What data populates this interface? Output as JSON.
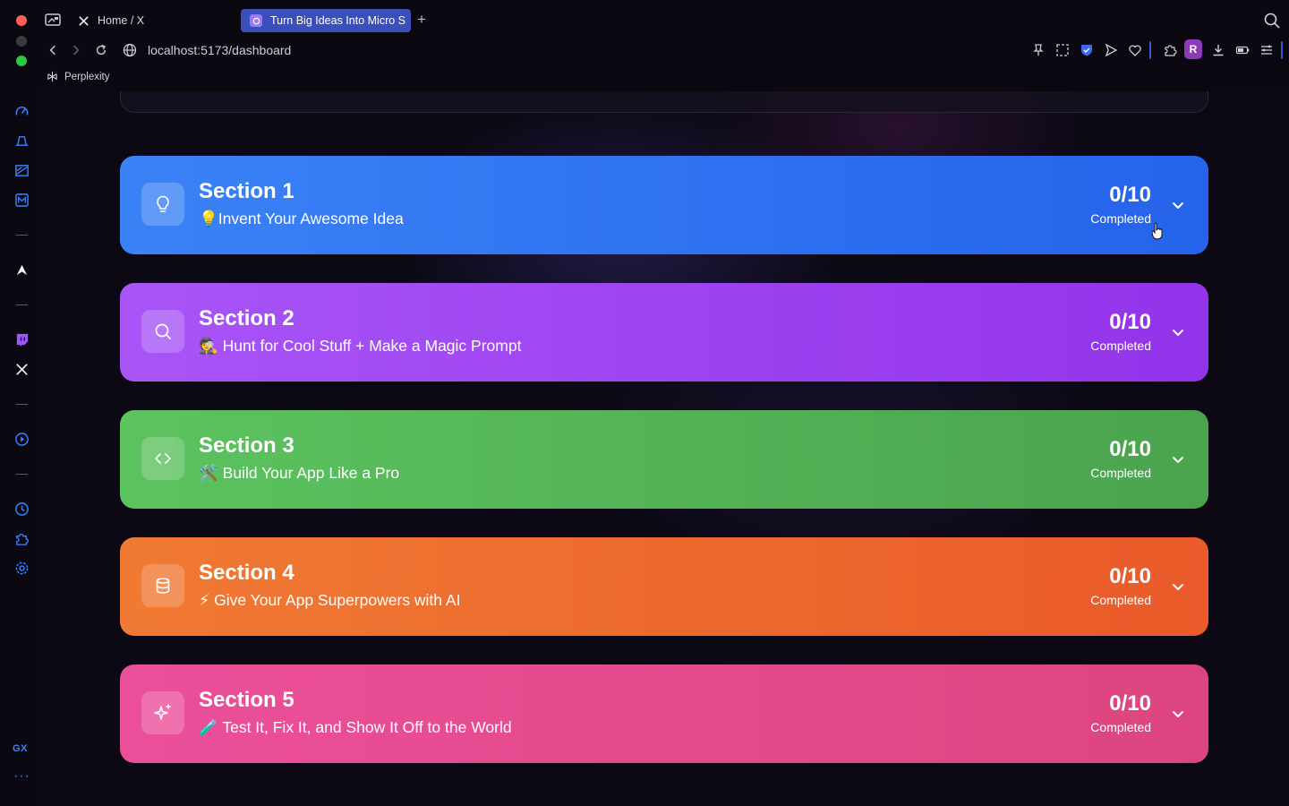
{
  "browser": {
    "tabs": [
      {
        "label": "Home / X",
        "icon": "x-logo-icon",
        "active": false
      },
      {
        "label": "Turn Big Ideas Into Micro S",
        "icon": "app-favicon-icon",
        "active": true
      }
    ],
    "url": "localhost:5173/dashboard",
    "avatar_letter": "R",
    "bookmarks": [
      {
        "label": "Perplexity",
        "icon": "perplexity-icon"
      }
    ],
    "accent_color": "#3b55d6"
  },
  "sidebar": {
    "icons": [
      "speed-dial-icon",
      "vpn-icon",
      "gallery-icon",
      "m-app-icon",
      "aria-icon",
      "twitch-icon",
      "x-icon",
      "player-icon",
      "history-icon",
      "extensions-icon",
      "settings-icon"
    ],
    "gx_label": "GX",
    "more_label": "···"
  },
  "sections": [
    {
      "title": "Section 1",
      "subtitle": "💡Invent Your Awesome Idea",
      "count": "0/10",
      "status": "Completed",
      "icon": "lightbulb-icon",
      "color": "#3b82f6"
    },
    {
      "title": "Section 2",
      "subtitle": "🕵️ Hunt for Cool Stuff + Make a Magic Prompt",
      "count": "0/10",
      "status": "Completed",
      "icon": "search-icon",
      "color": "#a855f7"
    },
    {
      "title": "Section 3",
      "subtitle": "🛠️ Build Your App Like a Pro",
      "count": "0/10",
      "status": "Completed",
      "icon": "code-icon",
      "color": "#5cc35f"
    },
    {
      "title": "Section 4",
      "subtitle": "⚡ Give Your App Superpowers with AI",
      "count": "0/10",
      "status": "Completed",
      "icon": "database-icon",
      "color": "#f07a33"
    },
    {
      "title": "Section 5",
      "subtitle": "🧪 Test It, Fix It, and Show It Off to the World",
      "count": "0/10",
      "status": "Completed",
      "icon": "sparkles-icon",
      "color": "#ec4f9a"
    }
  ]
}
